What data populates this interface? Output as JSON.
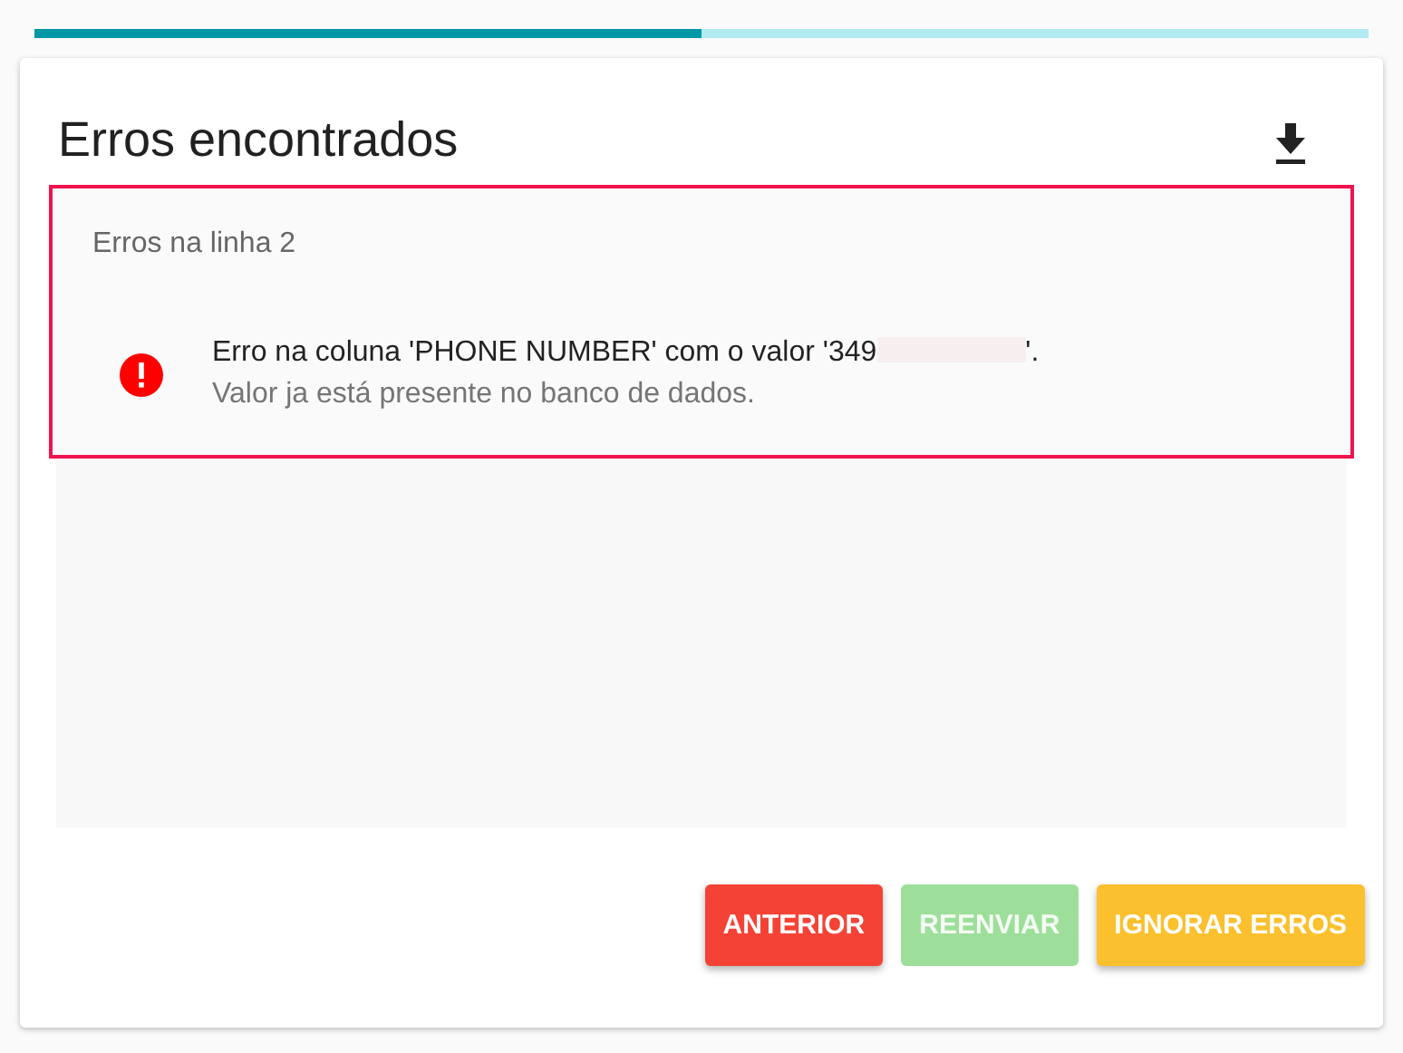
{
  "progress": {
    "level": 0.5
  },
  "card": {
    "title": "Erros encontrados"
  },
  "errors": [
    {
      "heading": "Erros na linha 2",
      "items": [
        {
          "message_start": "Erro na coluna 'PHONE NUMBER' com o valor '349",
          "redacted": true,
          "message_end": "'.",
          "detail": "Valor ja está presente no banco de dados."
        }
      ]
    }
  ],
  "buttons": [
    {
      "label": "ANTERIOR",
      "color": "#f44336",
      "disabled": false
    },
    {
      "label": "REENVIAR",
      "color": "#9ddf9a",
      "disabled": true
    },
    {
      "label": "IGNORAR ERROS",
      "color": "#fbc02d",
      "disabled": false
    }
  ]
}
